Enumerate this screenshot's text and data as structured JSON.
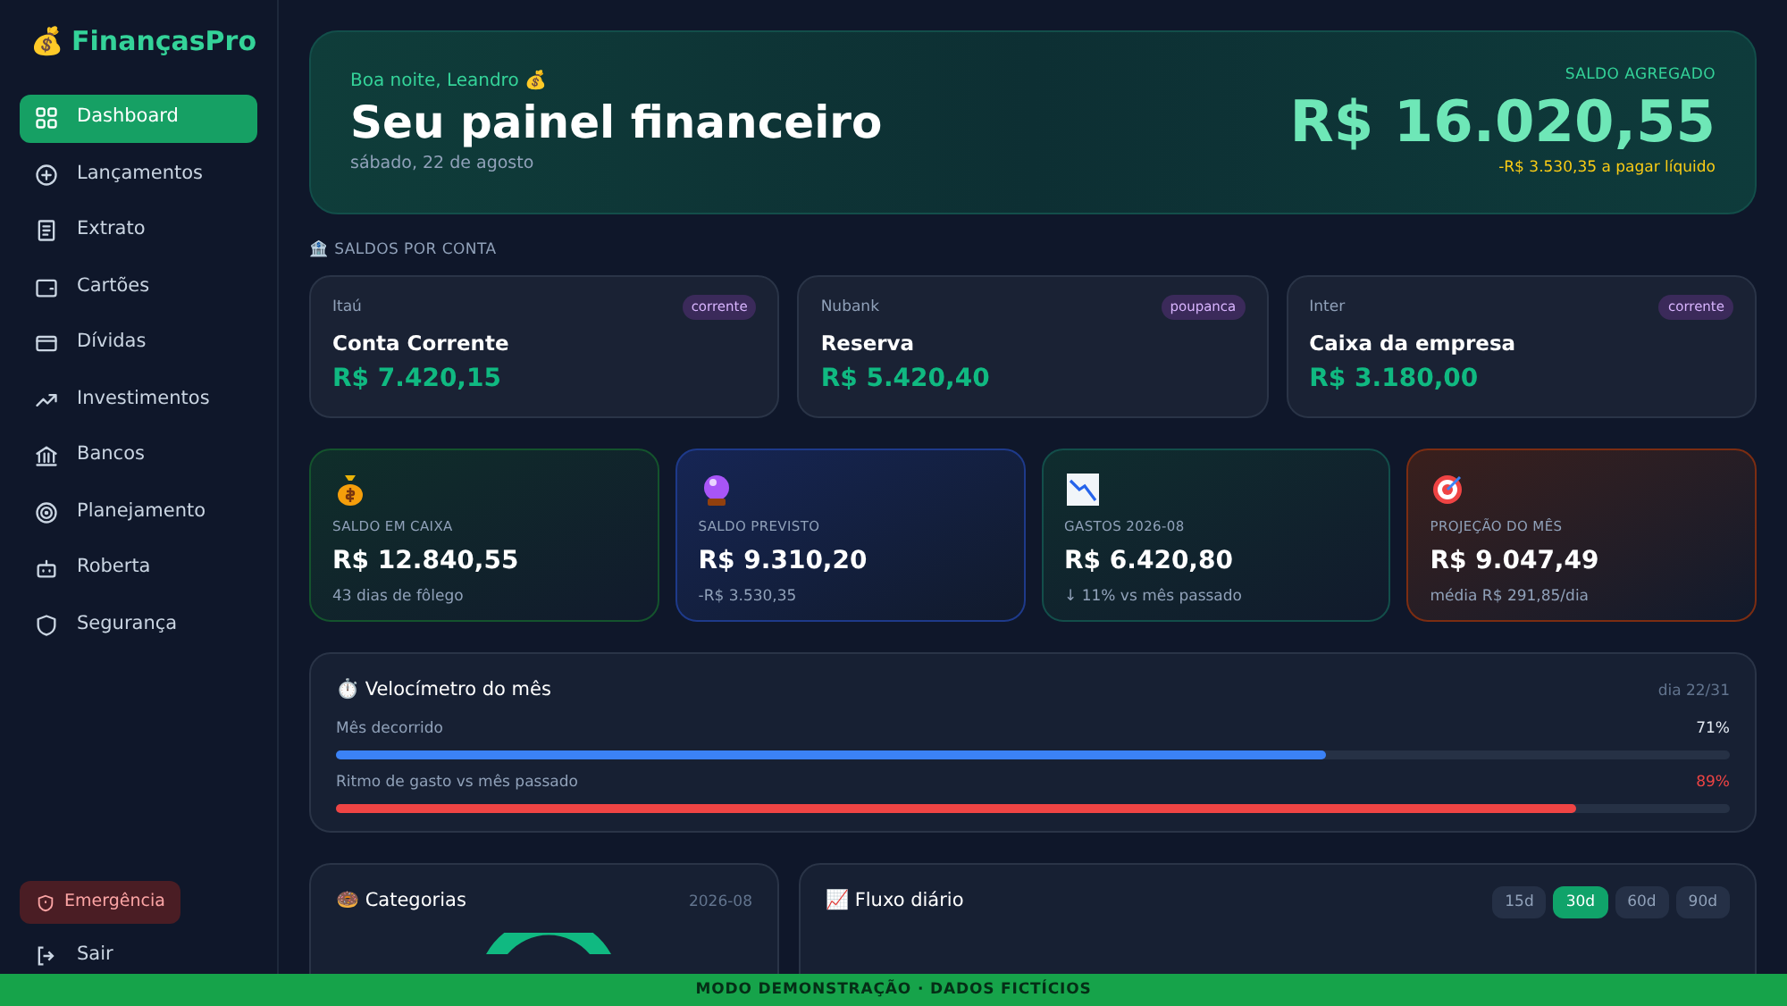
{
  "brand": {
    "icon": "💰",
    "name": "FinançasPro"
  },
  "sidebar": {
    "items": [
      {
        "label": "Dashboard",
        "kind": "grid",
        "selected": true
      },
      {
        "label": "Lançamentos",
        "kind": "plus",
        "selected": false
      },
      {
        "label": "Extrato",
        "kind": "receipt",
        "selected": false
      },
      {
        "label": "Cartões",
        "kind": "wallet",
        "selected": false
      },
      {
        "label": "Dívidas",
        "kind": "card",
        "selected": false
      },
      {
        "label": "Investimentos",
        "kind": "trend",
        "selected": false
      },
      {
        "label": "Bancos",
        "kind": "bank",
        "selected": false
      },
      {
        "label": "Planejamento",
        "kind": "target",
        "selected": false
      },
      {
        "label": "Roberta",
        "kind": "bot",
        "selected": false
      },
      {
        "label": "Segurança",
        "kind": "shield",
        "selected": false
      }
    ],
    "emergency": "Emergência",
    "logout": "Sair"
  },
  "hero": {
    "greeting": "Boa noite, Leandro 💰",
    "title": "Seu painel financeiro",
    "date": "sábado, 22 de agosto",
    "total_label": "SALDO AGREGADO",
    "total": "R$ 16.020,55",
    "pending": "-R$ 3.530,35 a pagar líquido"
  },
  "accounts_section": {
    "title": "🏦 SALDOS POR CONTA",
    "accounts": [
      {
        "bank": "Itaú",
        "tag": "corrente",
        "name": "Conta Corrente",
        "balance": "R$ 7.420,15"
      },
      {
        "bank": "Nubank",
        "tag": "poupanca",
        "name": "Reserva",
        "balance": "R$ 5.420,40"
      },
      {
        "bank": "Inter",
        "tag": "corrente",
        "name": "Caixa da empresa",
        "balance": "R$ 3.180,00"
      }
    ]
  },
  "stats": [
    {
      "kind": "cash",
      "label": "SALDO EM CAIXA",
      "value": "R$ 12.840,55",
      "note": "43 dias de fôlego"
    },
    {
      "kind": "forecast",
      "label": "SALDO PREVISTO",
      "value": "R$ 9.310,20",
      "note": "-R$ 3.530,35"
    },
    {
      "kind": "spending",
      "label": "GASTOS 2026-08",
      "value": "R$ 6.420,80",
      "note": "↓ 11% vs mês passado"
    },
    {
      "kind": "projection",
      "label": "PROJEÇÃO DO MÊS",
      "value": "R$ 9.047,49",
      "note": "média R$ 291,85/dia"
    }
  ],
  "speedometer": {
    "title": "⏱️ Velocímetro do mês",
    "day": "dia 22/31",
    "bars": [
      {
        "label": "Mês decorrido",
        "reading": "71%",
        "level": 0.71,
        "color": "#3b82f6"
      },
      {
        "label": "Ritmo de gasto vs mês passado",
        "reading": "89%",
        "level": 0.89,
        "color": "#ef4444"
      }
    ]
  },
  "categories": {
    "title": "🍩 Categorias",
    "period": "2026-08"
  },
  "daily_flow": {
    "title": "📈 Fluxo diário",
    "ranges": [
      {
        "label": "15d",
        "selected": false
      },
      {
        "label": "30d",
        "selected": true
      },
      {
        "label": "60d",
        "selected": false
      },
      {
        "label": "90d",
        "selected": false
      }
    ]
  },
  "banner": "MODO DEMONSTRAÇÃO · DADOS FICTÍCIOS"
}
